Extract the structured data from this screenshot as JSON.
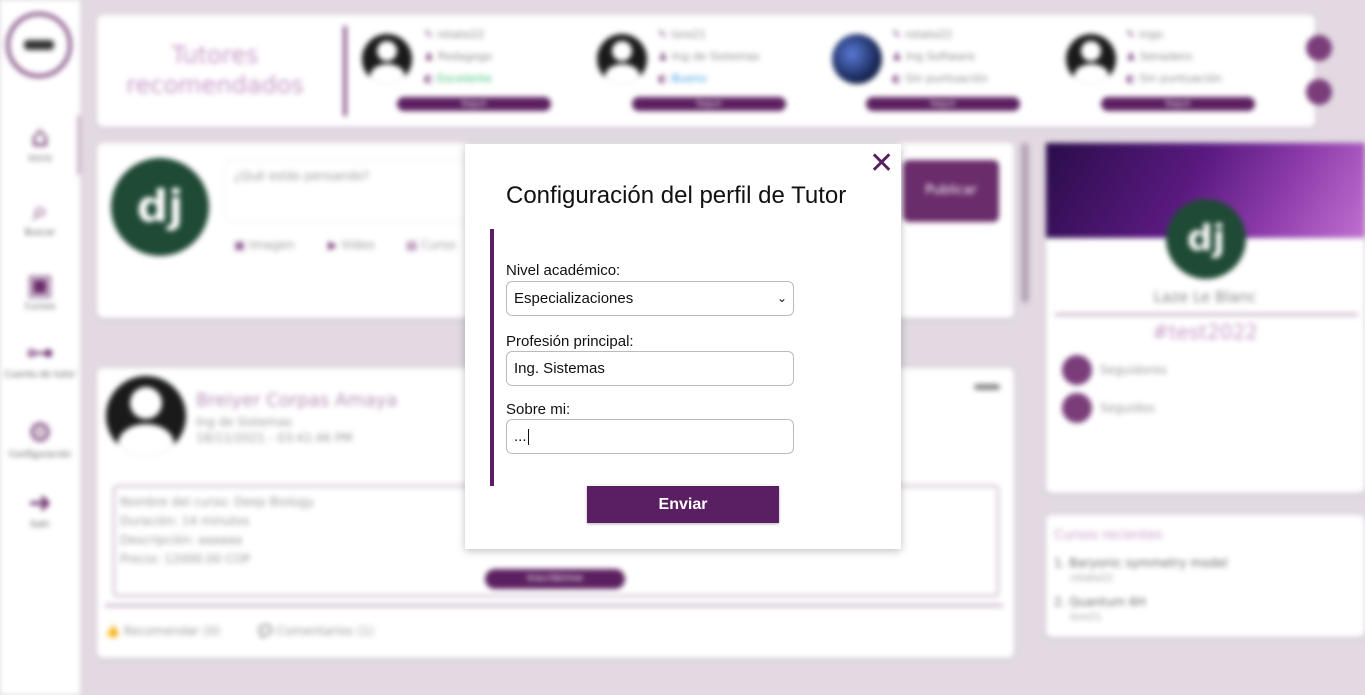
{
  "sidebar": {
    "items": [
      {
        "label": "Inicio",
        "icon": "home-icon"
      },
      {
        "label": "Buscar",
        "icon": "search-icon"
      },
      {
        "label": "Cursos",
        "icon": "courses-icon"
      },
      {
        "label": "Cuenta de tutor",
        "icon": "tutor-account-icon"
      },
      {
        "label": "Configuración",
        "icon": "settings-icon"
      },
      {
        "label": "Salir",
        "icon": "logout-icon"
      }
    ]
  },
  "recommended": {
    "title": "Tutores recomendados",
    "tutors": [
      {
        "name": "rotate22",
        "profession": "Pedagogo",
        "rating": "Excelente",
        "rating_color": "#38c172",
        "button": "Seguir"
      },
      {
        "name": "lore21",
        "profession": "Ing de Sistemas",
        "rating": "Bueno",
        "rating_color": "#3aa0e0",
        "button": "Seguir"
      },
      {
        "name": "rotate22",
        "profession": "Ing Software",
        "rating": "Sin puntuación",
        "rating_color": "#999999",
        "button": "Seguir"
      },
      {
        "name": "ingo",
        "profession": "Senadero",
        "rating": "Sin puntuación",
        "rating_color": "#999999",
        "button": "Seguir"
      }
    ]
  },
  "composer": {
    "placeholder": "¿Qué estás pensando?",
    "publish_label": "Publicar",
    "actions": [
      "Imagen",
      "Video",
      "Curso"
    ]
  },
  "post": {
    "author": "Breiyer Corpas Amaya",
    "profession": "Ing de Sistemas",
    "date": "18/11/2021 - 03:41:46 PM",
    "course_lines": [
      "Nombre del curso: Deep Biology",
      "Duración: 14 minutos",
      "Descripción: aaaaaa",
      "Precio: 12000.00 COP"
    ],
    "enroll_label": "Inscribirme",
    "recommend_label": "Recomendar (0)",
    "comments_label": "Comentarios (1)"
  },
  "profile": {
    "name": "Laze Le Blanc",
    "tag": "#test2022",
    "followers_label": "Seguidores",
    "following_label": "Seguidos"
  },
  "recent": {
    "title": "Cursos recientes",
    "items": [
      {
        "label": "1. Baryonic symmetry model",
        "author": "rotate22"
      },
      {
        "label": "2. Quantum 6H",
        "author": "lore21"
      }
    ]
  },
  "modal": {
    "title": "Configuración del perfil de Tutor",
    "academic_label": "Nivel académico:",
    "academic_value": "Especializaciones",
    "profession_label": "Profesión principal:",
    "profession_value": "Ing. Sistemas",
    "about_label": "Sobre mi:",
    "about_value": "...",
    "submit_label": "Enviar",
    "accent_color": "#5a1f62"
  }
}
